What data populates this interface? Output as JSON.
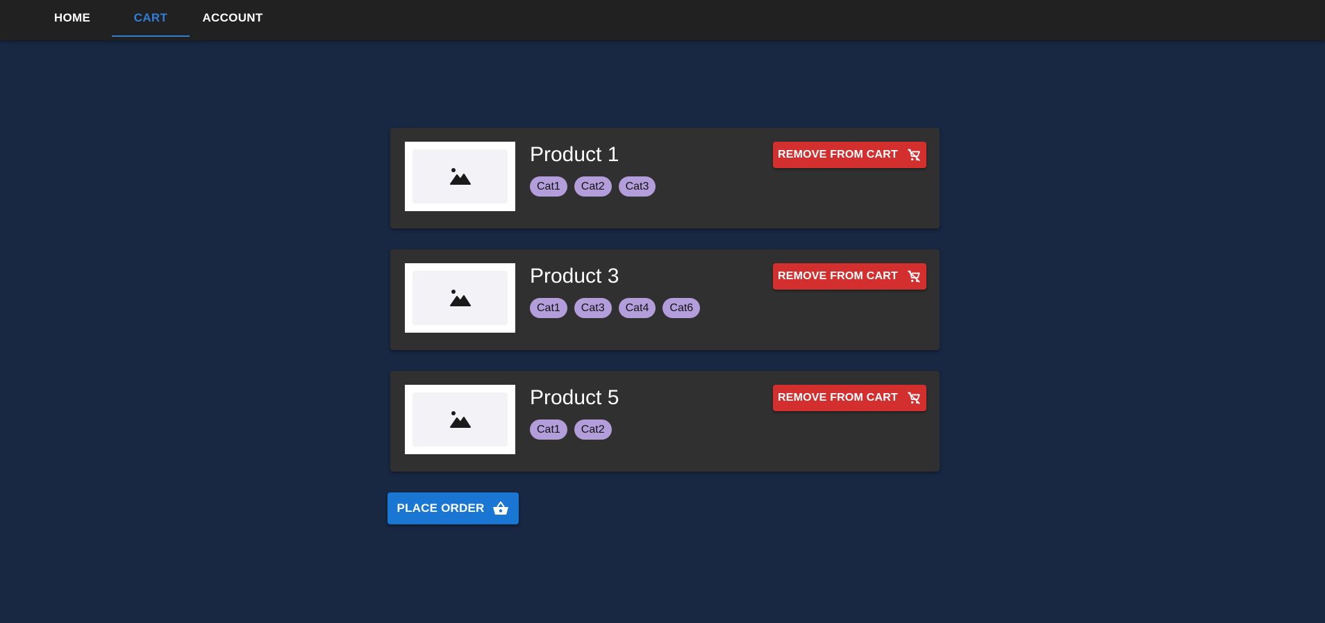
{
  "nav": {
    "tabs": [
      {
        "label": "HOME",
        "active": false
      },
      {
        "label": "CART",
        "active": true
      },
      {
        "label": "ACCOUNT",
        "active": false
      }
    ]
  },
  "cart": {
    "items": [
      {
        "title": "Product 1",
        "categories": [
          "Cat1",
          "Cat2",
          "Cat3"
        ],
        "remove_label": "REMOVE FROM CART",
        "image_icon": "image-placeholder-icon"
      },
      {
        "title": "Product 3",
        "categories": [
          "Cat1",
          "Cat3",
          "Cat4",
          "Cat6"
        ],
        "remove_label": "REMOVE FROM CART",
        "image_icon": "image-placeholder-icon"
      },
      {
        "title": "Product 5",
        "categories": [
          "Cat1",
          "Cat2"
        ],
        "remove_label": "REMOVE FROM CART",
        "image_icon": "image-placeholder-icon"
      }
    ],
    "place_order_label": "PLACE ORDER"
  },
  "colors": {
    "background": "#182742",
    "topbar": "#212121",
    "accent": "#2f7fd8",
    "card": "#303030",
    "chip": "#b39ddb",
    "remove": "#d32f2f",
    "order": "#1976d2"
  }
}
